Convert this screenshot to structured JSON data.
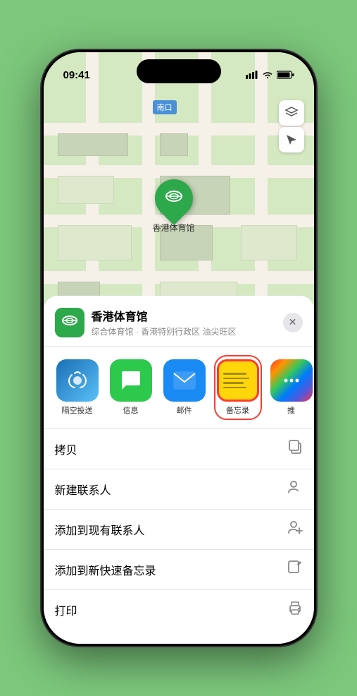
{
  "status_bar": {
    "time": "09:41",
    "signal_icon": "signal",
    "wifi_icon": "wifi",
    "battery_icon": "battery"
  },
  "map": {
    "label": "南口",
    "controls": {
      "map_type_icon": "map-layers",
      "location_icon": "arrow-up-right"
    },
    "marker": {
      "label": "香港体育馆",
      "icon": "stadium"
    }
  },
  "bottom_sheet": {
    "location": {
      "name": "香港体育馆",
      "subtitle": "综合体育馆 · 香港特别行政区 油尖旺区",
      "close_label": "✕"
    },
    "share_items": [
      {
        "id": "airdrop",
        "label": "隔空投送",
        "type": "airdrop"
      },
      {
        "id": "messages",
        "label": "信息",
        "type": "messages"
      },
      {
        "id": "mail",
        "label": "邮件",
        "type": "mail"
      },
      {
        "id": "notes",
        "label": "备忘录",
        "type": "notes"
      },
      {
        "id": "more",
        "label": "推",
        "type": "more"
      }
    ],
    "actions": [
      {
        "id": "copy",
        "label": "拷贝",
        "icon": "copy"
      },
      {
        "id": "new-contact",
        "label": "新建联系人",
        "icon": "person-add"
      },
      {
        "id": "add-to-contact",
        "label": "添加到现有联系人",
        "icon": "person-badge-plus"
      },
      {
        "id": "quick-note",
        "label": "添加到新快速备忘录",
        "icon": "square-pencil"
      },
      {
        "id": "print",
        "label": "打印",
        "icon": "printer"
      }
    ]
  }
}
